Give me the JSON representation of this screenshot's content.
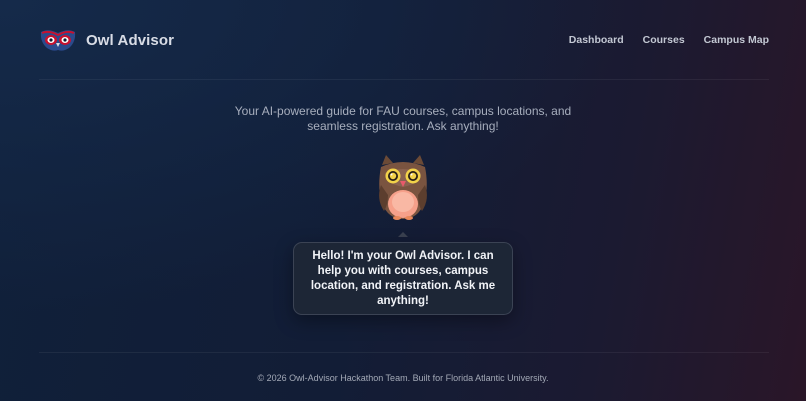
{
  "header": {
    "brand_name": "Owl Advisor",
    "logo_icon": "owl-logo-icon",
    "nav": [
      {
        "label": "Dashboard"
      },
      {
        "label": "Courses"
      },
      {
        "label": "Campus Map"
      }
    ]
  },
  "hero": {
    "tagline_lines": [
      "Your AI-powered guide for FAU courses, campus locations, and",
      "seamless registration. Ask anything!"
    ],
    "mascot_icon": "owl-mascot-icon"
  },
  "chat_bubble": {
    "lines": [
      "Hello! I'm your Owl Advisor. I can",
      "help you with courses, campus",
      "location, and registration. Ask me",
      "anything!"
    ]
  },
  "footer": {
    "text": "© 2026 Owl-Advisor Hackathon Team. Built for Florida Atlantic University."
  },
  "colors": {
    "background_start": "#10203a",
    "background_end": "#2a1628",
    "bubble_bg": "#1d2636",
    "logo_blue": "#2b4a8c",
    "logo_red": "#c8102e"
  }
}
